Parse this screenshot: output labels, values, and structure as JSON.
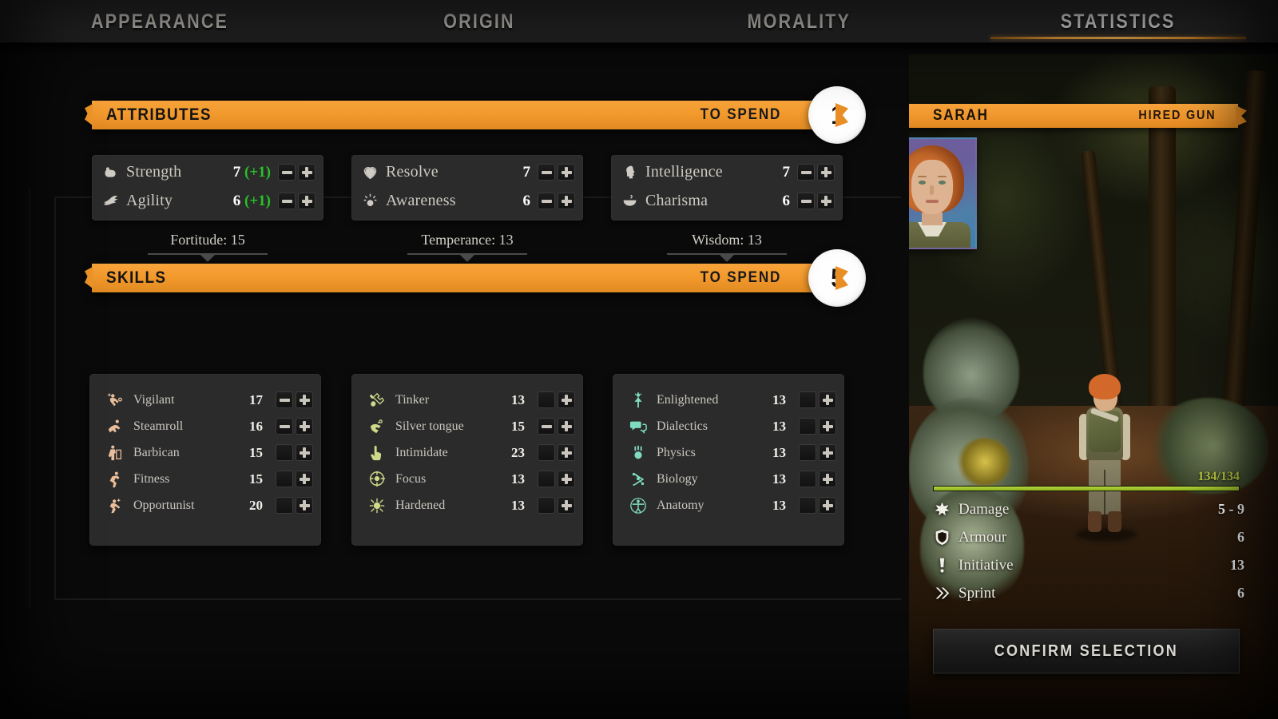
{
  "tabs": [
    {
      "label": "APPEARANCE",
      "active": false
    },
    {
      "label": "ORIGIN",
      "active": false
    },
    {
      "label": "MORALITY",
      "active": false
    },
    {
      "label": "STATISTICS",
      "active": true
    }
  ],
  "attributes_section": {
    "title": "ATTRIBUTES",
    "to_spend_label": "TO SPEND",
    "to_spend_value": "1",
    "groups": [
      {
        "derived_label": "Fortitude: 15",
        "rows": [
          {
            "icon": "bicep-icon",
            "name": "Strength",
            "value": "7",
            "bonus": "(+1)",
            "minus_enabled": true,
            "plus_enabled": true
          },
          {
            "icon": "wing-icon",
            "name": "Agility",
            "value": "6",
            "bonus": "(+1)",
            "minus_enabled": true,
            "plus_enabled": true
          }
        ]
      },
      {
        "derived_label": "Temperance: 13",
        "rows": [
          {
            "icon": "heart-pulse-icon",
            "name": "Resolve",
            "value": "7",
            "bonus": "",
            "minus_enabled": true,
            "plus_enabled": true
          },
          {
            "icon": "awareness-eye-icon",
            "name": "Awareness",
            "value": "6",
            "bonus": "",
            "minus_enabled": true,
            "plus_enabled": true
          }
        ]
      },
      {
        "derived_label": "Wisdom: 13",
        "rows": [
          {
            "icon": "brain-head-icon",
            "name": "Intelligence",
            "value": "7",
            "bonus": "",
            "minus_enabled": true,
            "plus_enabled": true
          },
          {
            "icon": "smile-mouth-icon",
            "name": "Charisma",
            "value": "6",
            "bonus": "",
            "minus_enabled": true,
            "plus_enabled": true
          }
        ]
      }
    ]
  },
  "skills_section": {
    "title": "SKILLS",
    "to_spend_label": "TO SPEND",
    "to_spend_value": "5",
    "columns": [
      {
        "accent": "#e8bd9a",
        "skills": [
          {
            "icon": "vigilant-icon",
            "name": "Vigilant",
            "value": "17",
            "minus_enabled": true
          },
          {
            "icon": "steamroll-icon",
            "name": "Steamroll",
            "value": "16",
            "minus_enabled": true
          },
          {
            "icon": "barbican-icon",
            "name": "Barbican",
            "value": "15",
            "minus_enabled": false
          },
          {
            "icon": "fitness-icon",
            "name": "Fitness",
            "value": "15",
            "minus_enabled": false
          },
          {
            "icon": "opportunist-icon",
            "name": "Opportunist",
            "value": "20",
            "minus_enabled": false
          }
        ]
      },
      {
        "accent": "#cfd98a",
        "skills": [
          {
            "icon": "wrench-icon",
            "name": "Tinker",
            "value": "13",
            "minus_enabled": false
          },
          {
            "icon": "silver-tongue-icon",
            "name": "Silver tongue",
            "value": "15",
            "minus_enabled": true
          },
          {
            "icon": "pointing-hand-icon",
            "name": "Intimidate",
            "value": "23",
            "minus_enabled": false
          },
          {
            "icon": "focus-target-icon",
            "name": "Focus",
            "value": "13",
            "minus_enabled": false
          },
          {
            "icon": "hardened-icon",
            "name": "Hardened",
            "value": "13",
            "minus_enabled": false
          }
        ]
      },
      {
        "accent": "#7fdcc0",
        "skills": [
          {
            "icon": "enlightened-icon",
            "name": "Enlightened",
            "value": "13",
            "minus_enabled": false
          },
          {
            "icon": "speech-bubbles-icon",
            "name": "Dialectics",
            "value": "13",
            "minus_enabled": false
          },
          {
            "icon": "atom-icon",
            "name": "Physics",
            "value": "13",
            "minus_enabled": false
          },
          {
            "icon": "dna-icon",
            "name": "Biology",
            "value": "13",
            "minus_enabled": false
          },
          {
            "icon": "vitruvian-icon",
            "name": "Anatomy",
            "value": "13",
            "minus_enabled": false
          }
        ]
      }
    ]
  },
  "character": {
    "name": "SARAH",
    "class": "HIRED GUN",
    "health_text": "134/134",
    "health_percent": 100,
    "stats": [
      {
        "icon": "burst-icon",
        "name": "Damage",
        "value": "5 - 9"
      },
      {
        "icon": "shield-icon",
        "name": "Armour",
        "value": "6"
      },
      {
        "icon": "exclamation-icon",
        "name": "Initiative",
        "value": "13"
      },
      {
        "icon": "double-chevron-icon",
        "name": "Sprint",
        "value": "6"
      }
    ],
    "confirm_label": "CONFIRM SELECTION"
  },
  "colors": {
    "accent_orange": "#f2992c",
    "health_green": "#b3d43c",
    "bonus_green": "#27c427"
  }
}
